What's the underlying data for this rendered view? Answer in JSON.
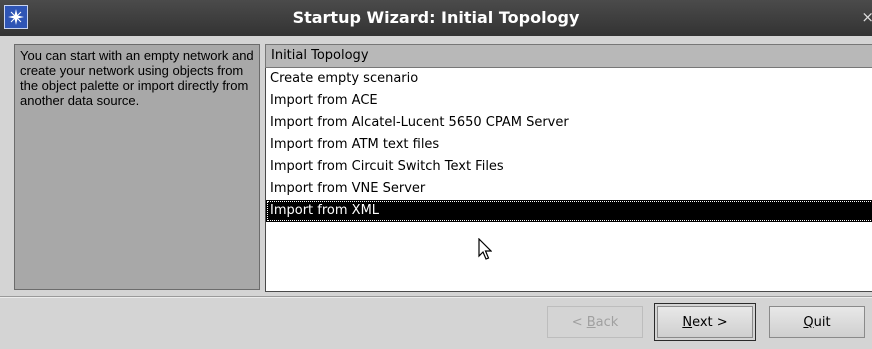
{
  "window": {
    "title": "Startup Wizard: Initial Topology",
    "close_glyph": "×"
  },
  "description": {
    "text": "You can start with an empty network and create your network using objects from the object palette or import directly from another data source."
  },
  "topology_list": {
    "header": "Initial Topology",
    "items": [
      "Create empty scenario",
      "Import from ACE",
      "Import from Alcatel-Lucent 5650 CPAM Server",
      "Import from ATM text files",
      "Import from Circuit Switch Text Files",
      "Import from VNE Server",
      "Import from XML"
    ],
    "selected": "Import from XML"
  },
  "buttons": {
    "back": {
      "mnemonic": "B",
      "prefix": "< ",
      "rest": "ack",
      "enabled": false
    },
    "next": {
      "mnemonic": "N",
      "prefix": "",
      "rest": "ext >",
      "enabled": true
    },
    "quit": {
      "mnemonic": "Q",
      "prefix": "",
      "rest": "uit",
      "enabled": true
    }
  },
  "icons": {
    "app": "wizard-star-icon",
    "cursor": "mouse-pointer-icon"
  },
  "colors": {
    "titlebar": "#3a3a3a",
    "panel_bg": "#a8a8a8",
    "selection": "#000000"
  }
}
